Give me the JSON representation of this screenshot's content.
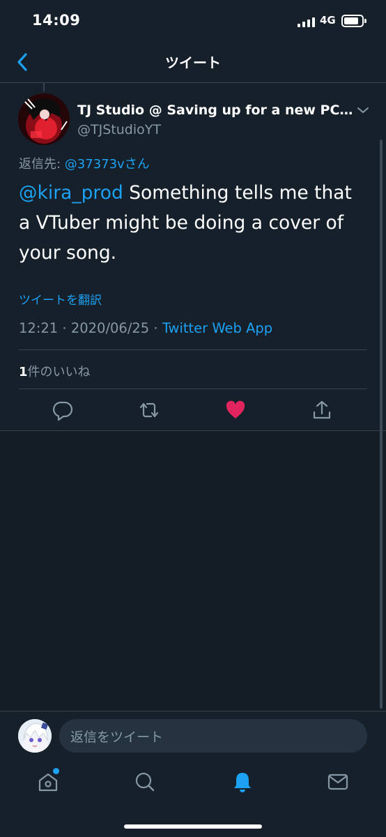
{
  "status_bar": {
    "time": "14:09",
    "network": "4G"
  },
  "header": {
    "title": "ツイート"
  },
  "tweet": {
    "display_name": "TJ Studio @ Saving up for a new PC...",
    "handle": "@TJStudioYT",
    "reply_to_label": "返信先: ",
    "reply_to_user": "@37373vさん",
    "mention": "@kira_prod",
    "text": " Something tells me that a VTuber might be doing a cover of your song.",
    "translate_label": "ツイートを翻訳",
    "time": "12:21",
    "date": "2020/06/25",
    "separator": " · ",
    "source": "Twitter Web App",
    "likes_count": "1",
    "likes_label": "件のいいね",
    "liked": true
  },
  "reply_bar": {
    "placeholder": "返信をツイート"
  },
  "icons": {
    "back": "chevron-left-icon",
    "caret": "chevron-down-icon",
    "reply": "comment-icon",
    "retweet": "retweet-icon",
    "like": "heart-icon",
    "share": "share-icon",
    "home": "home-icon",
    "search": "search-icon",
    "notifications": "bell-icon",
    "messages": "mail-icon"
  },
  "colors": {
    "background": "#15202b",
    "accent": "#1da1f2",
    "like": "#e0245e",
    "secondary_text": "#8899a6"
  }
}
